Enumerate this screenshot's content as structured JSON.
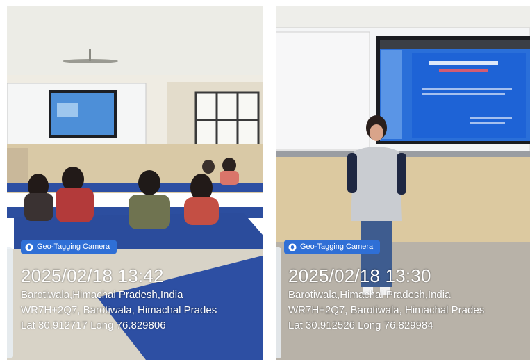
{
  "photos": [
    {
      "badge": "Geo-Tagging Camera",
      "timestamp": "2025/02/18 13:42",
      "place": "Barotiwala,Himachal Pradesh,India",
      "address": "WR7H+2Q7, Barotiwala, Himachal Prades",
      "coords": "Lat 30.912717 Long 76.829806"
    },
    {
      "badge": "Geo-Tagging Camera",
      "timestamp": "2025/02/18 13:30",
      "place": "Barotiwala,Himachal Pradesh,India",
      "address": "WR7H+2Q7, Barotiwala, Himachal Prades",
      "coords": "Lat 30.912526 Long 76.829984"
    }
  ],
  "colors": {
    "badge": "#2f6fd6",
    "desk": "#2d4fa3",
    "wall": "#d9c9a6",
    "screen": "#2a6fd9"
  },
  "icons": [
    "location-pin-icon"
  ]
}
